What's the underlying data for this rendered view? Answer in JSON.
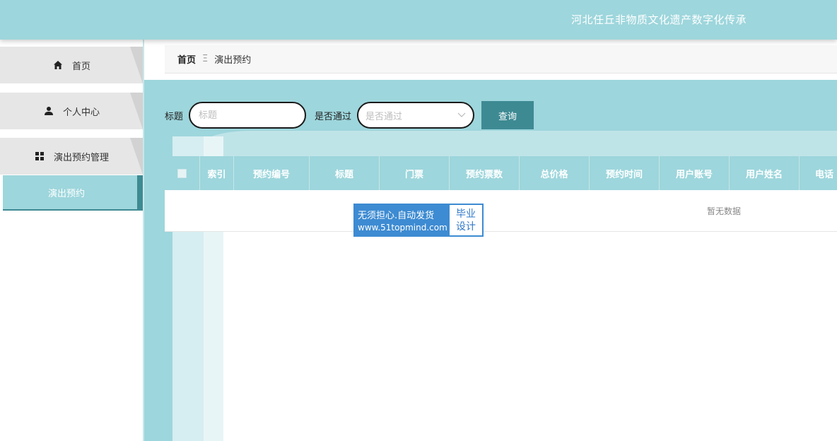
{
  "header": {
    "title": "河北任丘非物质文化遗产数字化传承"
  },
  "sidebar": {
    "items": [
      {
        "label": "首页",
        "icon": "home-icon"
      },
      {
        "label": "个人中心",
        "icon": "person-icon"
      },
      {
        "label": "演出预约管理",
        "icon": "grid-icon"
      }
    ],
    "subitems": [
      {
        "label": "演出预约"
      }
    ]
  },
  "breadcrumb": {
    "home": "首页",
    "separator": "Ξ",
    "current": "演出预约"
  },
  "search": {
    "title_label": "标题",
    "title_placeholder": "标题",
    "approved_label": "是否通过",
    "approved_placeholder": "是否通过",
    "query_button": "查询"
  },
  "table": {
    "columns": [
      "索引",
      "预约编号",
      "标题",
      "门票",
      "预约票数",
      "总价格",
      "预约时间",
      "用户账号",
      "用户姓名",
      "电话"
    ],
    "empty_text": "暂无数据"
  },
  "watermark": {
    "line1": "无须担心.自动发货",
    "line2": "www.51topmind.com",
    "badge_line1": "毕业",
    "badge_line2": "设计"
  },
  "colors": {
    "accent": "#9dd6dc",
    "button": "#3e8a93",
    "watermark": "#3d8bd2"
  }
}
